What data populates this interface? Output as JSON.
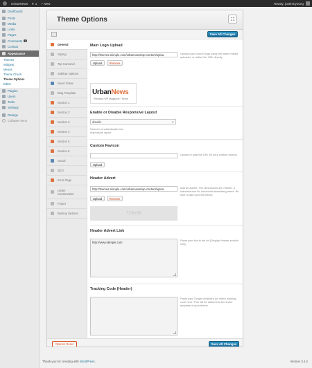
{
  "admin_bar": {
    "site_name": "UrbanNews",
    "comments_count": "1",
    "new_label": "+ New",
    "greeting": "Howdy, justinmyoung"
  },
  "sidebar": {
    "items": [
      {
        "label": "Dashboard",
        "icon": "dashboard-icon"
      },
      {
        "label": "Posts",
        "icon": "posts-icon"
      },
      {
        "label": "Media",
        "icon": "media-icon"
      },
      {
        "label": "Links",
        "icon": "links-icon"
      },
      {
        "label": "Pages",
        "icon": "pages-icon"
      },
      {
        "label": "Comments",
        "icon": "comments-icon",
        "badge": "1"
      },
      {
        "label": "Contact",
        "icon": "contact-icon"
      },
      {
        "label": "Appearance",
        "icon": "appearance-icon"
      }
    ],
    "appearance_sub": [
      "Themes",
      "Widgets",
      "Menus",
      "Theme Check",
      "Theme Options",
      "Editor"
    ],
    "items2": [
      {
        "label": "Plugins",
        "icon": "plugins-icon"
      },
      {
        "label": "Users",
        "icon": "users-icon"
      },
      {
        "label": "Tools",
        "icon": "tools-icon"
      },
      {
        "label": "Settings",
        "icon": "settings-icon"
      },
      {
        "label": "Ratings",
        "icon": "ratings-icon"
      }
    ],
    "collapse_label": "Collapse menu"
  },
  "panel": {
    "title": "Theme Options",
    "save_label": "Save All Changes",
    "reset_label": "Options Reset"
  },
  "tabs": [
    "General",
    "Styling",
    "Top Carousel",
    "Sidebar Options",
    "News Ticker",
    "Blog Template",
    "Section 1",
    "Section 2",
    "Section 3",
    "Section 4",
    "Section 5",
    "Section 6",
    "Social",
    "SEO",
    "Error Page",
    "Under Construction",
    "Footer",
    "Backup Options"
  ],
  "general": {
    "logo": {
      "title": "Main Logo Upload",
      "value": "http://themes.siiimple.com/urbannews/wp-content/uploa",
      "upload_label": "Upload",
      "remove_label": "Remove",
      "desc": "Upload your custom logo using the native media uploader, or define the URL directly",
      "logo_word_1": "Urban",
      "logo_word_2": "News",
      "logo_tagline": "Premium WP Magazine Theme"
    },
    "responsive": {
      "title": "Enable or Disable Responsive Layout",
      "value": "disable",
      "desc": "Select to enable/disable the responsive layout"
    },
    "favicon": {
      "title": "Custom Favicon",
      "value": "",
      "upload_label": "Upload",
      "desc": "Upload or past the URL for your custom favicon."
    },
    "advert": {
      "title": "Header Advert",
      "value": "http://themes.siiimple.com/urbannews/wp-content/uploa",
      "upload_label": "Upload",
      "remove_label": "Remove",
      "desc": "Add an Advert. The dimensions are 728x90, a standard size for horizontal advertising areas. Be sure to add your link below.",
      "placeholder_size": "728x90"
    },
    "advert_link": {
      "title": "Header Advert Link",
      "value": "http://www.siiimple.com",
      "desc": "Paste your link to the ad (Display Header section only)"
    },
    "tracking": {
      "title": "Tracking Code (Header)",
      "value": "",
      "desc": "Paste your Google Analytics (or other) tracking code here. This will be added into the footer template of your theme."
    }
  },
  "footer": {
    "thanks_prefix": "Thank you for creating with ",
    "wp_link": "WordPress",
    "thanks_suffix": ".",
    "version": "Version 3.4.2"
  }
}
